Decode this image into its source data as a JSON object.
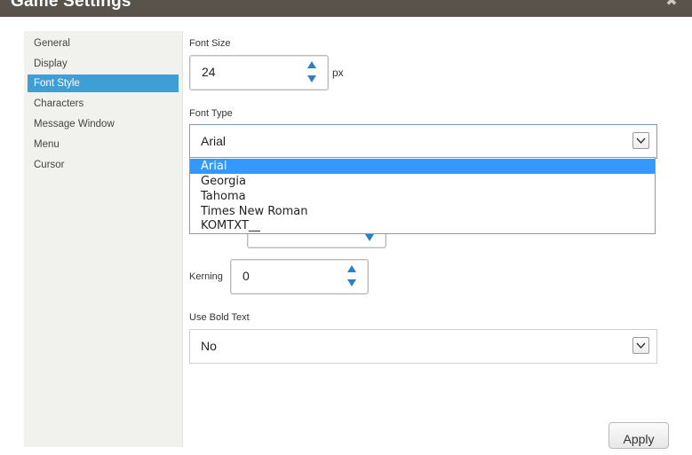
{
  "window": {
    "title": "Game Settings",
    "close_icon": "close-icon"
  },
  "sidebar": {
    "items": [
      {
        "label": "General"
      },
      {
        "label": "Display"
      },
      {
        "label": "Font Style",
        "active": true
      },
      {
        "label": "Characters"
      },
      {
        "label": "Message Window"
      },
      {
        "label": "Menu"
      },
      {
        "label": "Cursor"
      }
    ]
  },
  "font_size": {
    "label": "Font Size",
    "value": "24",
    "unit": "px"
  },
  "font_type": {
    "label": "Font Type",
    "selected": "Arial",
    "options": [
      "Arial",
      "Georgia",
      "Tahoma",
      "Times New Roman",
      "KOMTXT__"
    ]
  },
  "kerning": {
    "label": "Kerning",
    "value": "0"
  },
  "bold": {
    "label": "Use Bold Text",
    "selected": "No"
  },
  "actions": {
    "apply_label": "Apply"
  },
  "colors": {
    "accent": "#3d9fd6",
    "titlebar": "#5a534b",
    "dropdown_highlight": "#3399ff"
  }
}
